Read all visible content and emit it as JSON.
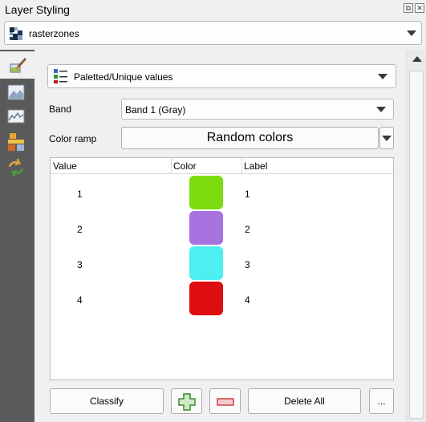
{
  "panel": {
    "title": "Layer Styling",
    "float_glyph": "⧉",
    "close_glyph": "✕"
  },
  "layer_selector": {
    "value": "rasterzones"
  },
  "sidebar": {
    "items": [
      {
        "name": "symbology",
        "icon": "paintbrush-icon",
        "active": true
      },
      {
        "name": "transparency",
        "icon": "raster-image-icon"
      },
      {
        "name": "histogram",
        "icon": "histogram-icon"
      },
      {
        "name": "rendering",
        "icon": "layers-stack-icon"
      },
      {
        "name": "history",
        "icon": "undo-redo-icon"
      }
    ]
  },
  "renderer": {
    "value": "Paletted/Unique values"
  },
  "form": {
    "band_label": "Band",
    "band_value": "Band 1 (Gray)",
    "color_ramp_label": "Color ramp",
    "color_ramp_value": "Random colors"
  },
  "table": {
    "headers": {
      "value": "Value",
      "color": "Color",
      "label": "Label"
    },
    "rows": [
      {
        "value": "1",
        "color": "#7ddc0f",
        "label": "1"
      },
      {
        "value": "2",
        "color": "#a872e0",
        "label": "2"
      },
      {
        "value": "3",
        "color": "#4cf0f0",
        "label": "3"
      },
      {
        "value": "4",
        "color": "#de0e10",
        "label": "4"
      }
    ]
  },
  "buttons": {
    "classify": "Classify",
    "delete_all": "Delete All",
    "more": "..."
  }
}
